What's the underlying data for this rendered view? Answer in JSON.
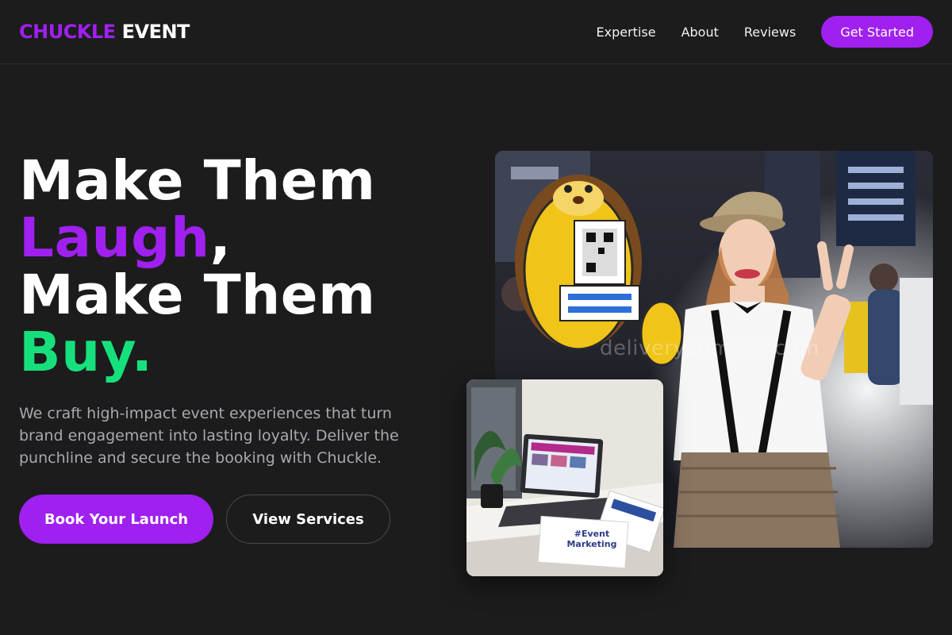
{
  "brand": {
    "part1": "CHUCKLE",
    "part2": "EVENT"
  },
  "nav": {
    "items": [
      "Expertise",
      "About",
      "Reviews"
    ],
    "cta": "Get Started"
  },
  "hero": {
    "line1": "Make Them",
    "laugh": "Laugh",
    "comma": ",",
    "line3": "Make Them",
    "buy": "Buy.",
    "subtitle": "We craft high-impact event experiences that turn brand engagement into lasting loyalty. Deliver the punchline and secure the booking with Chuckle.",
    "primary_button": "Book Your Launch",
    "secondary_button": "View Services"
  },
  "images": {
    "main_watermark": "deliverycomedy.com",
    "small_card_text": "#Event Marketing"
  },
  "colors": {
    "accent_purple": "#a020f0",
    "accent_green": "#16e07c",
    "background": "#1c1c1d"
  }
}
